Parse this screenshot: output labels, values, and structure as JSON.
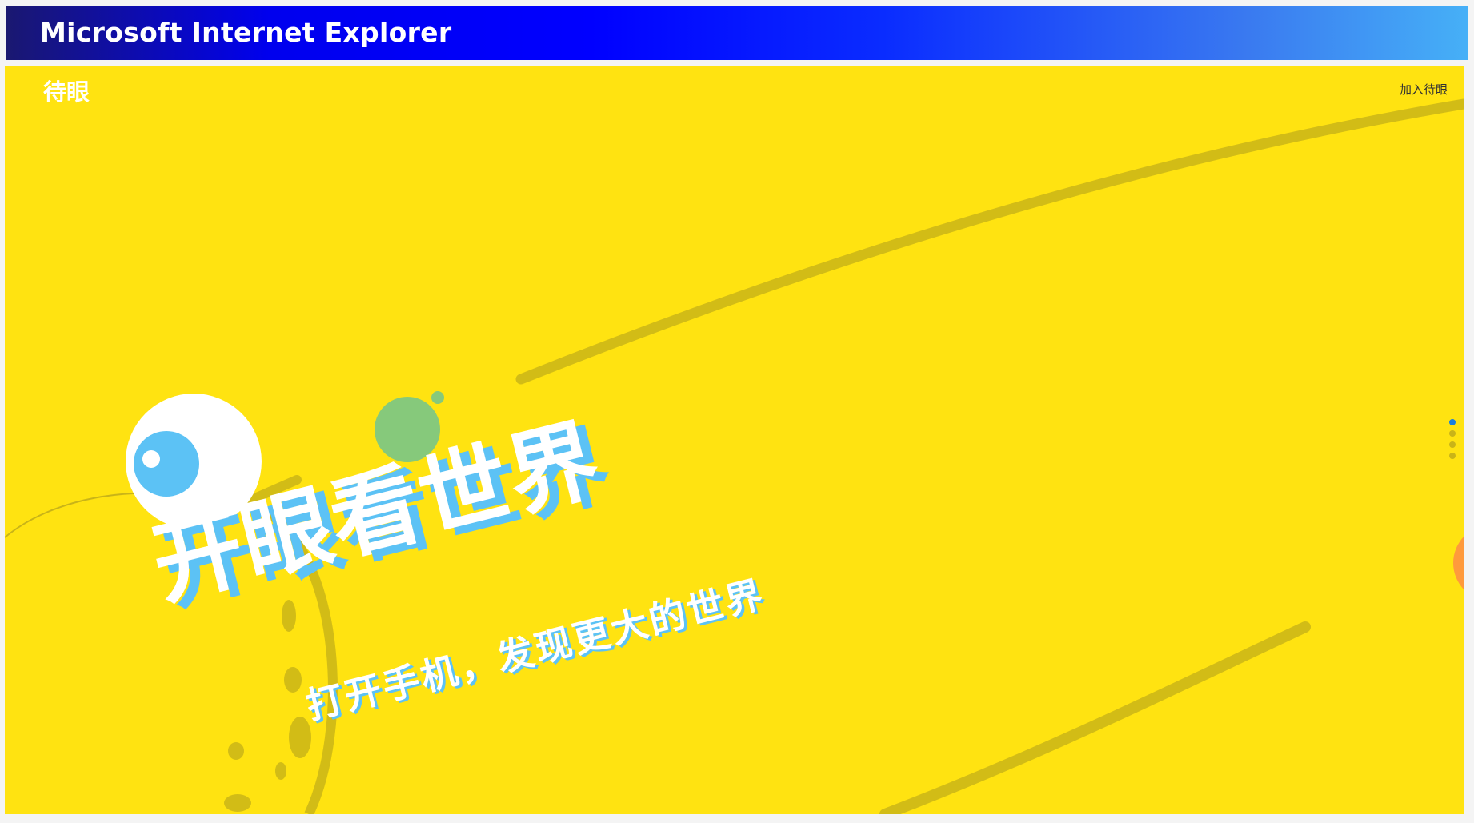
{
  "window": {
    "title": "Microsoft Internet Explorer"
  },
  "site": {
    "logo": "待眼",
    "join_link": "加入待眼"
  },
  "hero": {
    "headline": "开眼看世界",
    "subline": "打开手机，发现更大的世界",
    "background_color": "#ffe311",
    "accent_color": "#5cc2f5"
  },
  "pager": {
    "count": 4,
    "active_index": 0
  }
}
